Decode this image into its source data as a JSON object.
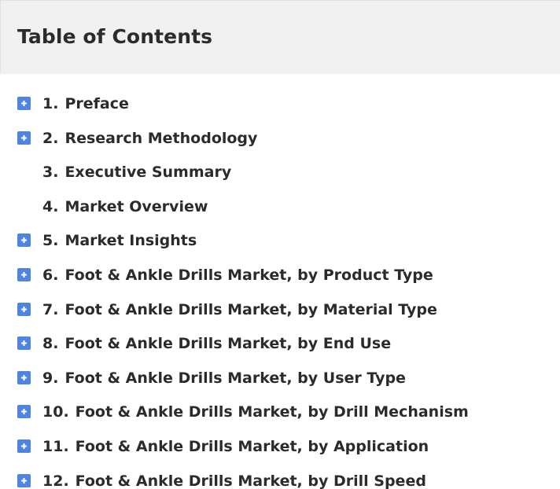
{
  "header": {
    "title": "Table of Contents"
  },
  "colors": {
    "expander": "#4f84e0",
    "header_bg": "#f1f1f1",
    "text": "#2b2b2b"
  },
  "toc": {
    "items": [
      {
        "num": "1.",
        "label": "Preface",
        "expandable": true
      },
      {
        "num": "2.",
        "label": "Research Methodology",
        "expandable": true
      },
      {
        "num": "3.",
        "label": "Executive Summary",
        "expandable": false
      },
      {
        "num": "4.",
        "label": "Market Overview",
        "expandable": false
      },
      {
        "num": "5.",
        "label": "Market Insights",
        "expandable": true
      },
      {
        "num": "6.",
        "label": "Foot & Ankle Drills Market, by Product Type",
        "expandable": true
      },
      {
        "num": "7.",
        "label": "Foot & Ankle Drills Market, by Material Type",
        "expandable": true
      },
      {
        "num": "8.",
        "label": "Foot & Ankle Drills Market, by End Use",
        "expandable": true
      },
      {
        "num": "9.",
        "label": "Foot & Ankle Drills Market, by User Type",
        "expandable": true
      },
      {
        "num": "10.",
        "label": "Foot & Ankle Drills Market, by Drill Mechanism",
        "expandable": true
      },
      {
        "num": "11.",
        "label": "Foot & Ankle Drills Market, by Application",
        "expandable": true
      },
      {
        "num": "12.",
        "label": "Foot & Ankle Drills Market, by Drill Speed",
        "expandable": true
      }
    ]
  }
}
